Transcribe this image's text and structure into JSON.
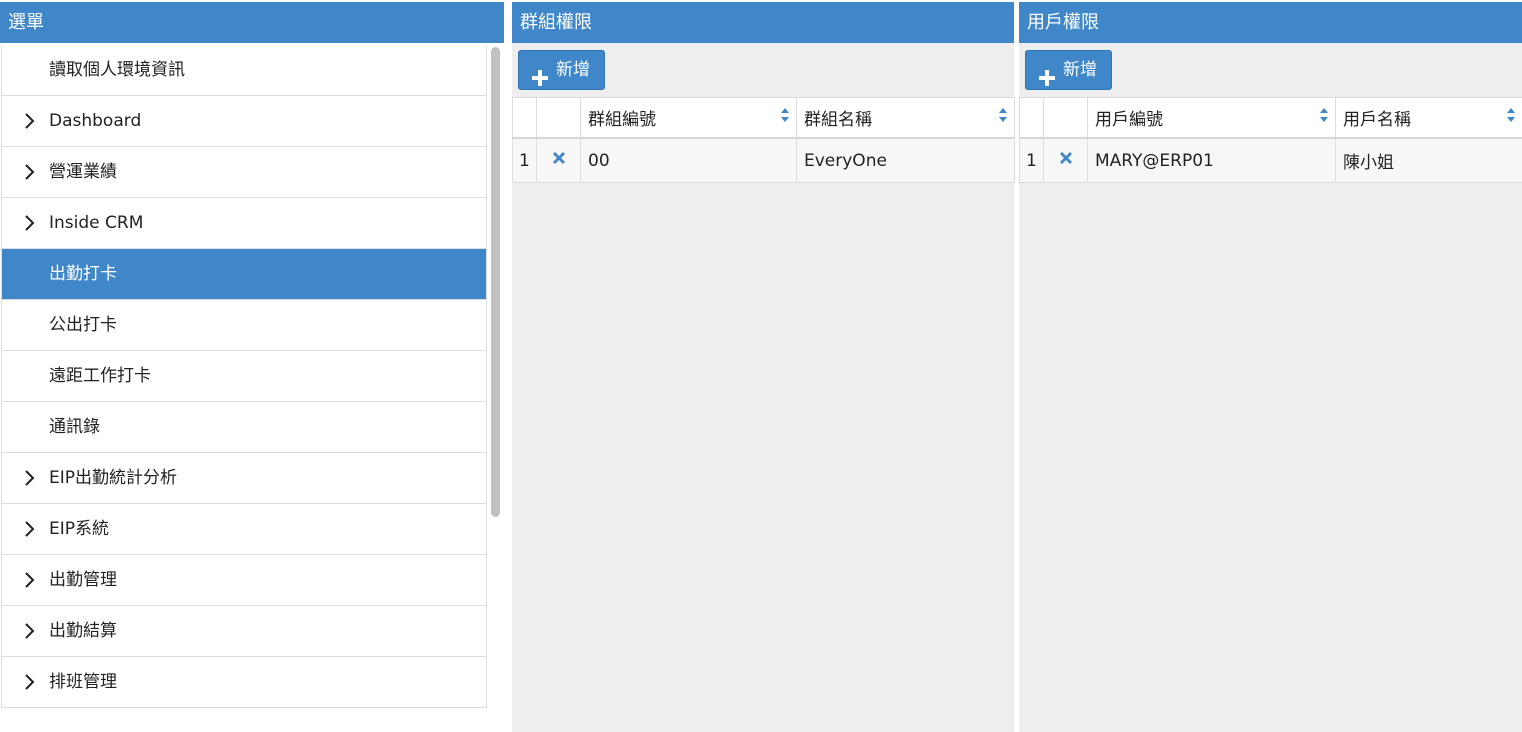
{
  "colors": {
    "accent": "#3f87c9",
    "selected": "#3f87c9",
    "panel_bg": "#eeeeee"
  },
  "menu": {
    "title": "選單",
    "items": [
      {
        "label": "讀取個人環境資訊",
        "expandable": false,
        "selected": false
      },
      {
        "label": "Dashboard",
        "expandable": true,
        "selected": false
      },
      {
        "label": "營運業績",
        "expandable": true,
        "selected": false
      },
      {
        "label": "Inside CRM",
        "expandable": true,
        "selected": false
      },
      {
        "label": "出勤打卡",
        "expandable": false,
        "selected": true
      },
      {
        "label": "公出打卡",
        "expandable": false,
        "selected": false
      },
      {
        "label": "遠距工作打卡",
        "expandable": false,
        "selected": false
      },
      {
        "label": "通訊錄",
        "expandable": false,
        "selected": false
      },
      {
        "label": "EIP出勤統計分析",
        "expandable": true,
        "selected": false
      },
      {
        "label": "EIP系統",
        "expandable": true,
        "selected": false
      },
      {
        "label": "出勤管理",
        "expandable": true,
        "selected": false
      },
      {
        "label": "出勤結算",
        "expandable": true,
        "selected": false
      },
      {
        "label": "排班管理",
        "expandable": true,
        "selected": false
      }
    ]
  },
  "group_panel": {
    "title": "群組權限",
    "add_label": "新增",
    "columns": [
      "群組編號",
      "群組名稱"
    ],
    "rows": [
      {
        "num": "1",
        "id": "00",
        "name": "EveryOne"
      }
    ]
  },
  "user_panel": {
    "title": "用戶權限",
    "add_label": "新增",
    "columns": [
      "用戶編號",
      "用戶名稱"
    ],
    "rows": [
      {
        "num": "1",
        "id": "MARY@ERP01",
        "name": "陳小姐"
      }
    ]
  }
}
